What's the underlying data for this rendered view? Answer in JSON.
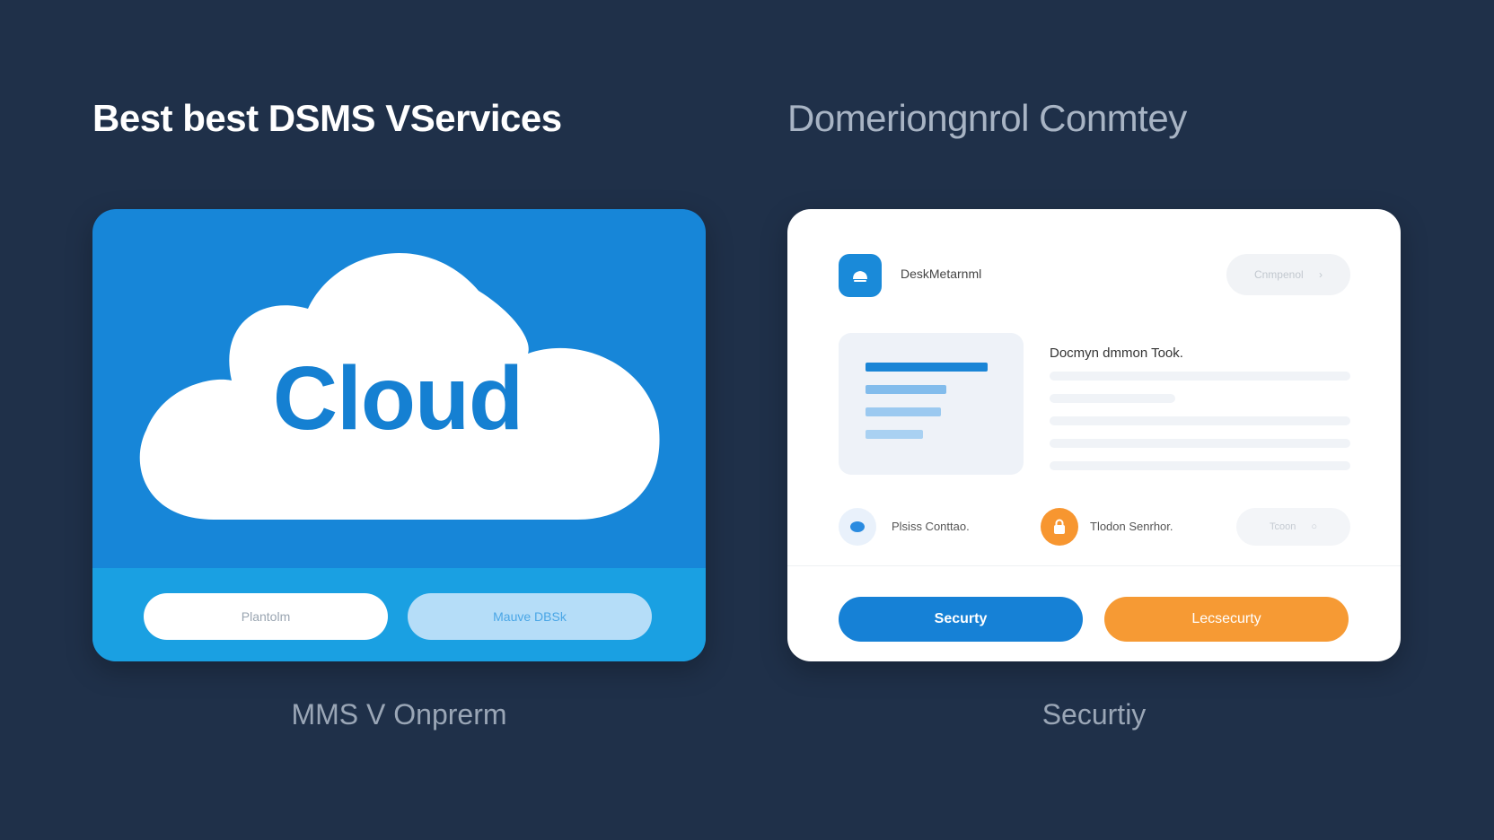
{
  "headings": {
    "left": "Best best DSMS VServices",
    "right": "Domeriongnrol Conmtey"
  },
  "cloud_card": {
    "cloud_label": "Cloud",
    "button_primary": "Plantolm",
    "button_secondary": "Mauve DBSk",
    "colors": {
      "card": "#1786d8",
      "footer": "#1aa0e2",
      "text": "#1580d2"
    }
  },
  "tool_card": {
    "app_name": "DeskMetarnml",
    "top_pill": "Cnmpenol",
    "doc_title": "Docmyn dmmon Took.",
    "row_items": [
      {
        "label": "Plsiss Conttao.",
        "icon": "blue-dot-icon"
      },
      {
        "label": "Tlodon Senrhor.",
        "icon": "orange-lock-icon"
      }
    ],
    "row_pill": "Tcoon",
    "actions": {
      "primary": "Securty",
      "secondary": "Lecsecurty"
    },
    "colors": {
      "primary": "#1681d6",
      "secondary": "#f69a34"
    }
  },
  "captions": {
    "left": "MMS V Onprerm",
    "right": "Securtiy"
  }
}
